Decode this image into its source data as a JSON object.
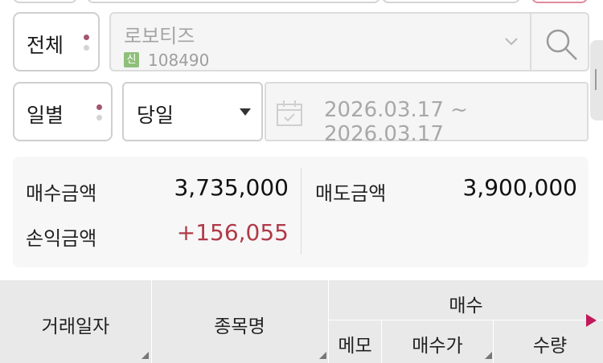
{
  "filter": {
    "scope_label": "전체",
    "period_label": "일별",
    "range_label": "당일"
  },
  "stock": {
    "name": "로보티즈",
    "badge": "신",
    "code": "108490"
  },
  "date_range": "2026.03.17 ~ 2026.03.17",
  "summary": {
    "buy_amount_label": "매수금액",
    "buy_amount": "3,735,000",
    "sell_amount_label": "매도금액",
    "sell_amount": "3,900,000",
    "pnl_label": "손익금액",
    "pnl": "+156,055"
  },
  "table": {
    "col_date": "거래일자",
    "col_name": "종목명",
    "group_buy": "매수",
    "col_memo": "메모",
    "col_buy_price": "매수가",
    "col_qty": "수량"
  },
  "colors": {
    "accent_dot": "#a3566e",
    "profit_red": "#b03a48",
    "next_arrow": "#c2185b"
  },
  "icons": {
    "search": "search-icon",
    "chevron": "chevron-down-icon",
    "caret": "caret-down-icon",
    "calendar": "calendar-icon",
    "next": "play-right-icon"
  }
}
